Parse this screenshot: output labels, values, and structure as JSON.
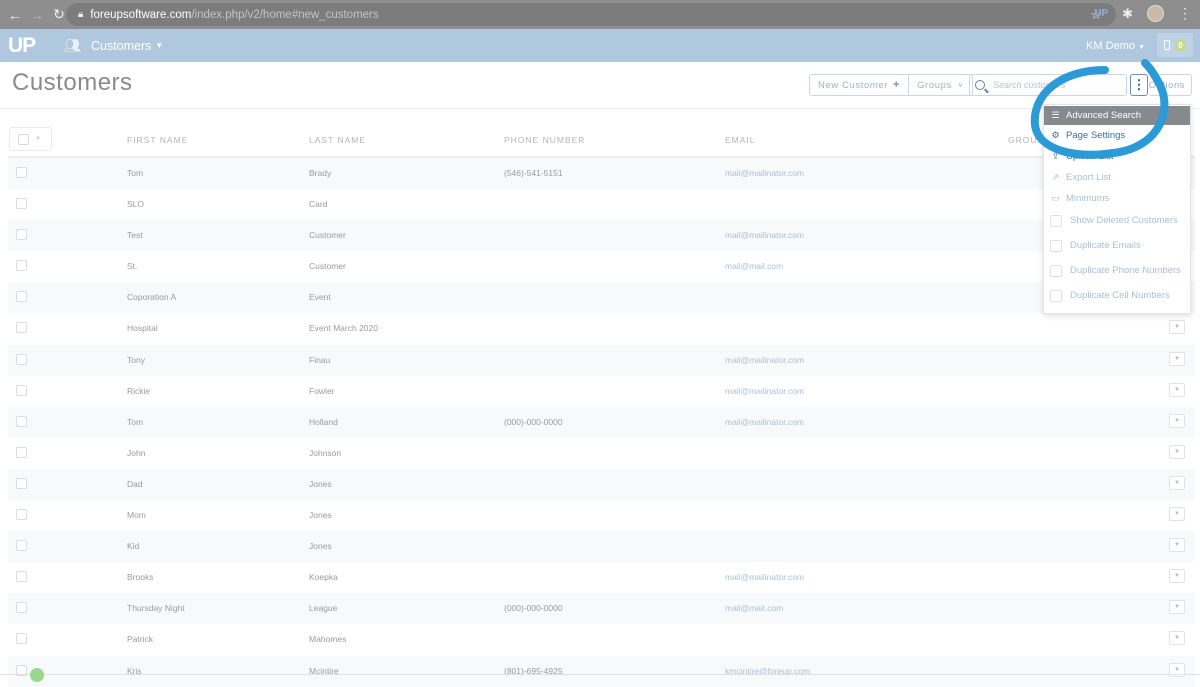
{
  "browser": {
    "url_host": "foreupsoftware.com",
    "url_path": "/index.php/v2/home#new_customers",
    "extension_label": "UP"
  },
  "app": {
    "logo": "UP",
    "module": "Customers",
    "user": "KM Demo",
    "notification_count": "0"
  },
  "page": {
    "title": "Customers",
    "new_customer_label": "New Customer",
    "groups_label": "Groups",
    "search_placeholder": "Search customers",
    "options_label": "Options"
  },
  "table": {
    "columns": [
      "FIRST NAME",
      "LAST NAME",
      "PHONE NUMBER",
      "EMAIL",
      "GROUPS"
    ],
    "rows": [
      {
        "first": "Tom",
        "last": "Brady",
        "phone": "(546)-541-5151",
        "email": "mail@mailinator.com"
      },
      {
        "first": "SLO",
        "last": "Card",
        "phone": "",
        "email": ""
      },
      {
        "first": "Test",
        "last": "Customer",
        "phone": "",
        "email": "mail@mailinator.com"
      },
      {
        "first": "St.",
        "last": "Customer",
        "phone": "",
        "email": "mail@mail.com"
      },
      {
        "first": "Coporation A",
        "last": "Event",
        "phone": "",
        "email": ""
      },
      {
        "first": "Hospital",
        "last": "Event March 2020",
        "phone": "",
        "email": ""
      },
      {
        "first": "Tony",
        "last": "Finau",
        "phone": "",
        "email": "mail@mailinator.com"
      },
      {
        "first": "Rickie",
        "last": "Fowler",
        "phone": "",
        "email": "mail@mailinator.com"
      },
      {
        "first": "Tom",
        "last": "Holland",
        "phone": "(000)-000-0000",
        "email": "mail@mailinator.com"
      },
      {
        "first": "John",
        "last": "Johnson",
        "phone": "",
        "email": ""
      },
      {
        "first": "Dad",
        "last": "Jones",
        "phone": "",
        "email": ""
      },
      {
        "first": "Mom",
        "last": "Jones",
        "phone": "",
        "email": ""
      },
      {
        "first": "Kid",
        "last": "Jones",
        "phone": "",
        "email": ""
      },
      {
        "first": "Brooks",
        "last": "Koepka",
        "phone": "",
        "email": "mail@mailinator.com"
      },
      {
        "first": "Thursday Night",
        "last": "League",
        "phone": "(000)-000-0000",
        "email": "mail@mail.com"
      },
      {
        "first": "Patrick",
        "last": "Mahomes",
        "phone": "",
        "email": ""
      },
      {
        "first": "Kris",
        "last": "Mcintire",
        "phone": "(801)-695-4925",
        "email": "kmcintire@foreup.com"
      }
    ]
  },
  "menu": {
    "items": [
      {
        "label": "Advanced Search",
        "icon": "sliders-icon"
      },
      {
        "label": "Page Settings",
        "icon": "gears-icon"
      },
      {
        "label": "Upload List",
        "icon": "upload-icon"
      },
      {
        "label": "Export List",
        "icon": "export-icon"
      },
      {
        "label": "Minimums",
        "icon": "card-icon"
      }
    ],
    "checkboxes": [
      {
        "label": "Show Deleted Customers",
        "checked": false
      },
      {
        "label": "Duplicate Emails",
        "checked": false
      },
      {
        "label": "Duplicate Phone Numbers",
        "checked": false
      },
      {
        "label": "Duplicate Cell Numbers",
        "checked": false
      }
    ]
  },
  "colors": {
    "header_bg": "#b0c8de",
    "link": "#a9c1d8",
    "annotation": "#2b9ad6",
    "active_menu": "#858a8f"
  }
}
